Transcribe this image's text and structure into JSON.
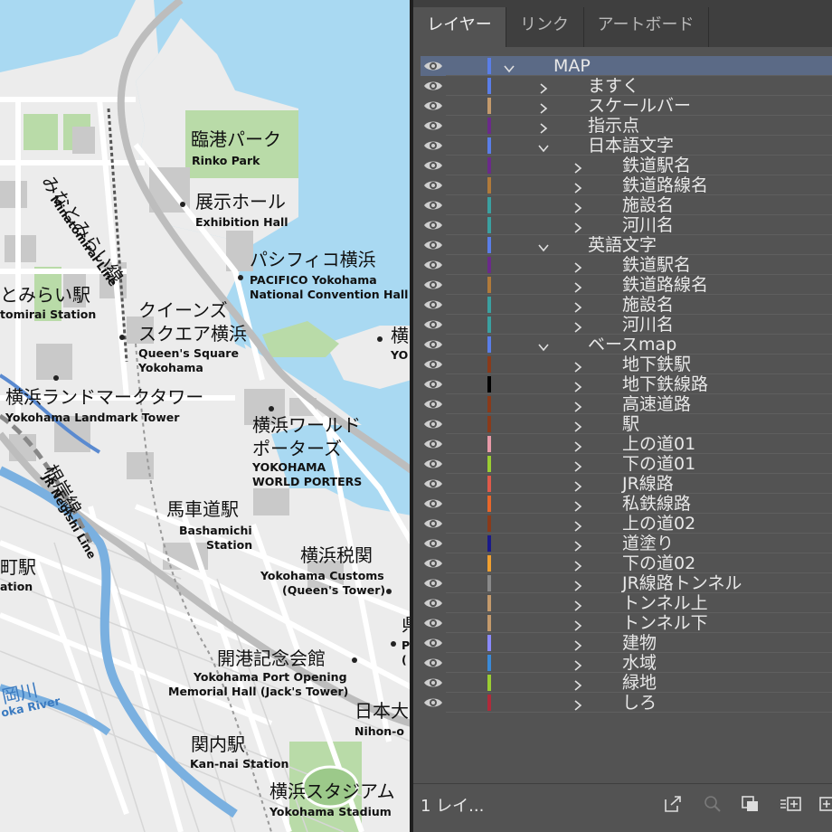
{
  "map": {
    "labels": [
      {
        "id": "rinko-ja",
        "text": "臨港パーク"
      },
      {
        "id": "rinko-en",
        "text": "Rinko Park"
      },
      {
        "id": "exhibition-ja",
        "text": "展示ホール"
      },
      {
        "id": "exhibition-en",
        "text": "Exhibition Hall"
      },
      {
        "id": "pacifico-ja",
        "text": "パシフィコ横浜"
      },
      {
        "id": "pacifico-en1",
        "text": "PACIFICO Yokohama"
      },
      {
        "id": "pacifico-en2",
        "text": "National Convention Hall"
      },
      {
        "id": "minatomirai-line-ja",
        "text": "みなとみらい線"
      },
      {
        "id": "minatomirai-line-en",
        "text": "Minatomirai Line"
      },
      {
        "id": "minatomirai-st-ja",
        "text": "とみらい駅"
      },
      {
        "id": "minatomirai-st-en",
        "text": "tomirai Station"
      },
      {
        "id": "queens-ja1",
        "text": "クイーンズ"
      },
      {
        "id": "queens-ja2",
        "text": "スクエア横浜"
      },
      {
        "id": "queens-en1",
        "text": "Queen's Square"
      },
      {
        "id": "queens-en2",
        "text": "Yokohama"
      },
      {
        "id": "yoko-cut-ja",
        "text": "横"
      },
      {
        "id": "yoko-cut-en",
        "text": "YO"
      },
      {
        "id": "landmark-ja",
        "text": "横浜ランドマークタワー"
      },
      {
        "id": "landmark-en",
        "text": "Yokohama Landmark Tower"
      },
      {
        "id": "worldporters-ja1",
        "text": "横浜ワールド"
      },
      {
        "id": "worldporters-ja2",
        "text": "ポーターズ"
      },
      {
        "id": "worldporters-en1",
        "text": "YOKOHAMA"
      },
      {
        "id": "worldporters-en2",
        "text": "WORLD PORTERS"
      },
      {
        "id": "negishi-ja",
        "text": "根岸線"
      },
      {
        "id": "negishi-en",
        "text": "JR Negishi Line"
      },
      {
        "id": "bashamichi-ja",
        "text": "馬車道駅"
      },
      {
        "id": "bashamichi-en1",
        "text": "Bashamichi"
      },
      {
        "id": "bashamichi-en2",
        "text": "Station"
      },
      {
        "id": "customs-ja",
        "text": "横浜税関"
      },
      {
        "id": "customs-en1",
        "text": "Yokohama Customs"
      },
      {
        "id": "customs-en2",
        "text": "(Queen's Tower)"
      },
      {
        "id": "machi-ja",
        "text": "町駅"
      },
      {
        "id": "machi-en",
        "text": "ation"
      },
      {
        "id": "kaiko-ja",
        "text": "開港記念会館"
      },
      {
        "id": "kaiko-en1",
        "text": "Yokohama Port Opening"
      },
      {
        "id": "kaiko-en2",
        "text": "Memorial Hall (Jack's Tower)"
      },
      {
        "id": "ken-cut-ja",
        "text": "県"
      },
      {
        "id": "ken-cut-en1",
        "text": "P"
      },
      {
        "id": "ken-cut-en2",
        "text": "("
      },
      {
        "id": "nihon-ja",
        "text": "日本大"
      },
      {
        "id": "nihon-en",
        "text": "Nihon-o"
      },
      {
        "id": "ooka-ja",
        "text": "岡川"
      },
      {
        "id": "ooka-en",
        "text": "oka River"
      },
      {
        "id": "kannai-ja",
        "text": "関内駅"
      },
      {
        "id": "kannai-en",
        "text": "Kan-nai Station"
      },
      {
        "id": "stadium-ja",
        "text": "横浜スタジアム"
      },
      {
        "id": "stadium-en",
        "text": "Yokohama Stadium"
      }
    ]
  },
  "panel": {
    "tabs": [
      {
        "label": "レイヤー",
        "active": true
      },
      {
        "label": "リンク",
        "active": false
      },
      {
        "label": "アートボード",
        "active": false
      }
    ],
    "layers": [
      {
        "name": "MAP",
        "level": 0,
        "color": "#5a7ee8",
        "expanded": true,
        "selected": true
      },
      {
        "name": "ますく",
        "level": 1,
        "color": "#5a7ee8",
        "expanded": false
      },
      {
        "name": "スケールバー",
        "level": 1,
        "color": "#c49a6c",
        "expanded": false
      },
      {
        "name": "指示点",
        "level": 1,
        "color": "#6b2a8a",
        "expanded": false
      },
      {
        "name": "日本語文字",
        "level": 1,
        "color": "#5a7ee8",
        "expanded": true
      },
      {
        "name": "鉄道駅名",
        "level": 2,
        "color": "#6b2a8a",
        "expanded": false
      },
      {
        "name": "鉄道路線名",
        "level": 2,
        "color": "#b07a3a",
        "expanded": false
      },
      {
        "name": "施設名",
        "level": 2,
        "color": "#3aa0a0",
        "expanded": false
      },
      {
        "name": "河川名",
        "level": 2,
        "color": "#3aa0a0",
        "expanded": false
      },
      {
        "name": "英語文字",
        "level": 1,
        "color": "#5a7ee8",
        "expanded": true
      },
      {
        "name": "鉄道駅名",
        "level": 2,
        "color": "#6b2a8a",
        "expanded": false
      },
      {
        "name": "鉄道路線名",
        "level": 2,
        "color": "#b07a3a",
        "expanded": false
      },
      {
        "name": "施設名",
        "level": 2,
        "color": "#3aa0a0",
        "expanded": false
      },
      {
        "name": "河川名",
        "level": 2,
        "color": "#3aa0a0",
        "expanded": false
      },
      {
        "name": "ベースmap",
        "level": 1,
        "color": "#5a7ee8",
        "expanded": true
      },
      {
        "name": "地下鉄駅",
        "level": 2,
        "color": "#8a3a1a",
        "expanded": false
      },
      {
        "name": "地下鉄線路",
        "level": 2,
        "color": "#000000",
        "expanded": false
      },
      {
        "name": "高速道路",
        "level": 2,
        "color": "#8a3a1a",
        "expanded": false
      },
      {
        "name": "駅",
        "level": 2,
        "color": "#8a3a1a",
        "expanded": false
      },
      {
        "name": "上の道01",
        "level": 2,
        "color": "#e89aa8",
        "expanded": false
      },
      {
        "name": "下の道01",
        "level": 2,
        "color": "#9acd32",
        "expanded": false
      },
      {
        "name": "JR線路",
        "level": 2,
        "color": "#e05a4a",
        "expanded": false
      },
      {
        "name": "私鉄線路",
        "level": 2,
        "color": "#e8662a",
        "expanded": false
      },
      {
        "name": "上の道02",
        "level": 2,
        "color": "#8a3a1a",
        "expanded": false
      },
      {
        "name": "道塗り",
        "level": 2,
        "color": "#1a1a8a",
        "expanded": false
      },
      {
        "name": "下の道02",
        "level": 2,
        "color": "#f0a030",
        "expanded": false
      },
      {
        "name": "JR線路トンネル",
        "level": 2,
        "color": "#8a8a8a",
        "expanded": false
      },
      {
        "name": "トンネル上",
        "level": 2,
        "color": "#c49a6c",
        "expanded": false
      },
      {
        "name": "トンネル下",
        "level": 2,
        "color": "#c49a6c",
        "expanded": false
      },
      {
        "name": "建物",
        "level": 2,
        "color": "#8a8aff",
        "expanded": false
      },
      {
        "name": "水域",
        "level": 2,
        "color": "#3a8ad8",
        "expanded": false
      },
      {
        "name": "緑地",
        "level": 2,
        "color": "#9acd32",
        "expanded": false
      },
      {
        "name": "しろ",
        "level": 2,
        "color": "#b02a3a",
        "expanded": false
      }
    ],
    "footer": {
      "count_label": "1 レイ..."
    }
  }
}
